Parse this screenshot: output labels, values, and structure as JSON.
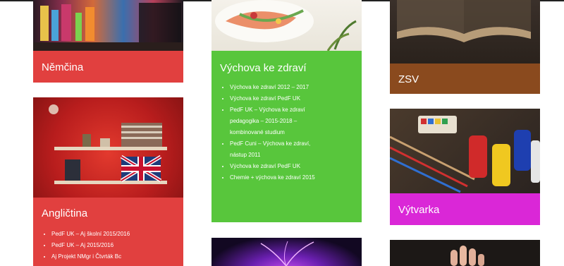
{
  "colors": {
    "red": "#e1403f",
    "green": "#58c63c",
    "brown": "#8a4a1e",
    "magenta": "#da27d7"
  },
  "cards": {
    "nemcina": {
      "title": "Němčina",
      "image": "book-shelf-photo"
    },
    "vychova": {
      "title": "Výchova ke zdraví",
      "image": "salad-photo",
      "links": [
        "Výchova ke zdraví 2012 – 2017",
        "Výchova ke zdraví PedF UK",
        "PedF UK – Výchova ke zdraví ",
        "pedagogika – 2015-2018 –",
        "kombinované studium",
        "PedF Cuni – Výchova ke zdraví,",
        "nástup 2011",
        "Výchova ke zdraví PedF UK",
        "Chemie + výchova ke zdraví 2015"
      ]
    },
    "zsv": {
      "title": "ZSV",
      "image": "open-book-photo"
    },
    "anglictina": {
      "title": "Angličtina",
      "image": "union-jack-shelf-photo",
      "links": [
        "PedF UK – Aj školní 2015/2016",
        "PedF UK – Aj 2015/2016",
        "Aj Projekt NMgr i Čtvrták Bc"
      ]
    },
    "vytvarka": {
      "title": "Výtvarka",
      "image": "paint-brushes-photo"
    },
    "plasma": {
      "image": "plasma-ball-photo"
    },
    "hand": {
      "image": "hand-photo"
    }
  }
}
